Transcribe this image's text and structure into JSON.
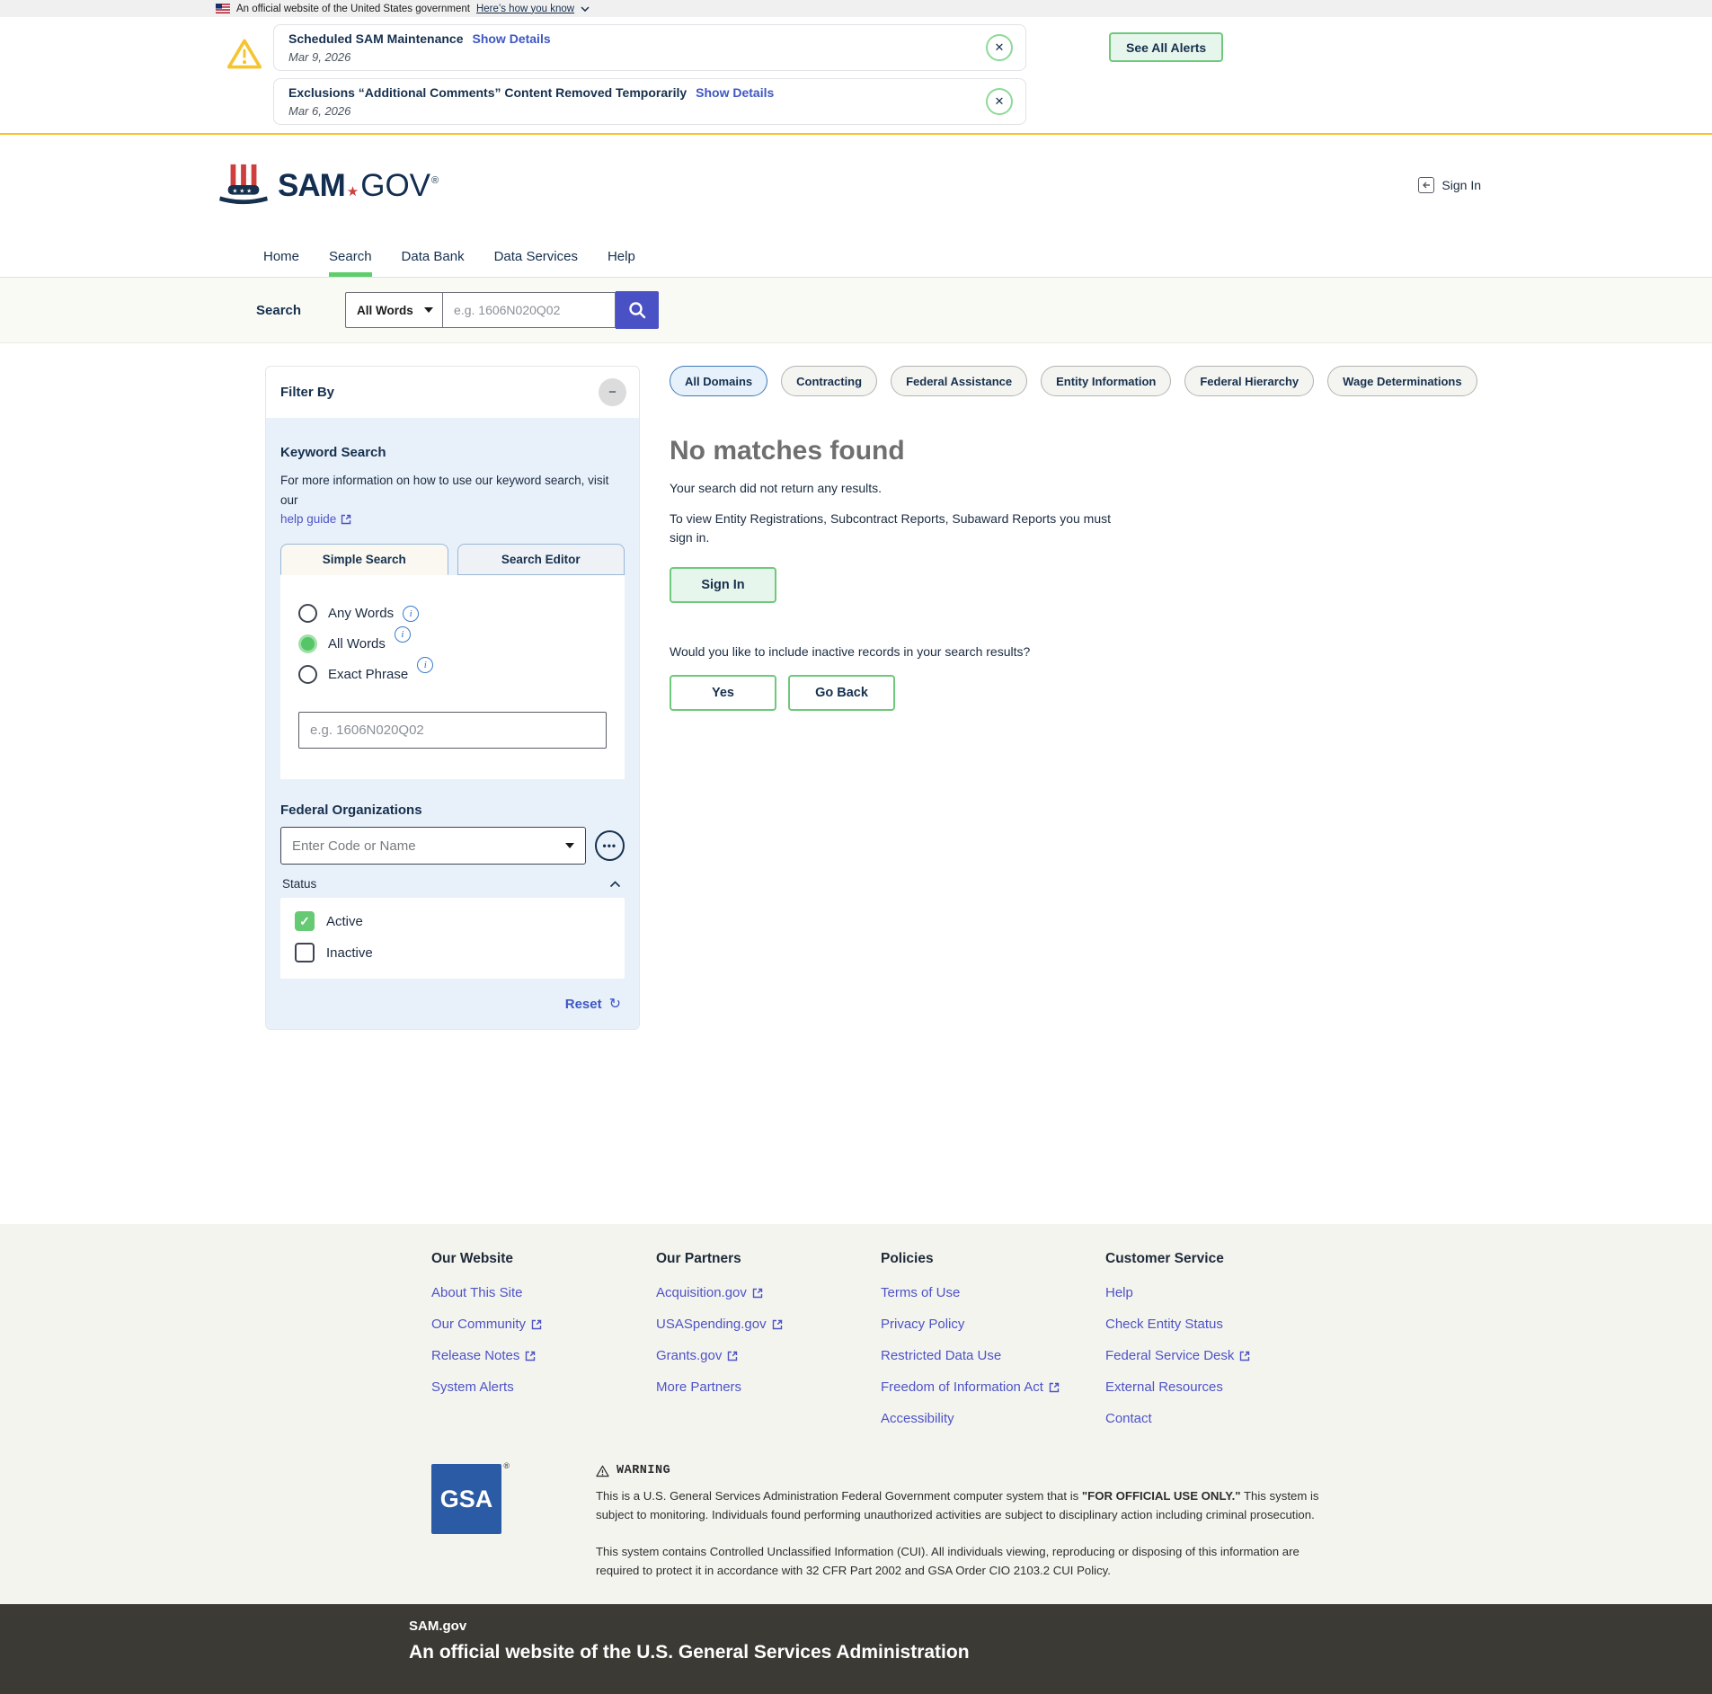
{
  "theme": {
    "accent_gold": "#ffbe2e",
    "brand_navy": "#16304e",
    "link_indigo": "#4d53c6",
    "success_green": "#6fc97c",
    "primary_blue": "#4a51c4",
    "gsa_blue": "#2c5ba6"
  },
  "gov_banner": {
    "text": "An official website of the United States government",
    "link": "Here’s how you know"
  },
  "alerts": {
    "items": [
      {
        "title": "Scheduled SAM Maintenance",
        "details_link": "Show Details",
        "date": "Mar 9, 2026"
      },
      {
        "title": "Exclusions “Additional Comments” Content Removed Temporarily",
        "details_link": "Show Details",
        "date": "Mar 6, 2026"
      }
    ],
    "see_all_label": "See All Alerts"
  },
  "header": {
    "logo": {
      "sam": "SAM",
      "gov": "GOV",
      "reg": "®"
    },
    "sign_in_label": "Sign In"
  },
  "nav": {
    "items": [
      {
        "label": "Home",
        "active": false
      },
      {
        "label": "Search",
        "active": true
      },
      {
        "label": "Data Bank",
        "active": false
      },
      {
        "label": "Data Services",
        "active": false
      },
      {
        "label": "Help",
        "active": false
      }
    ]
  },
  "search_bar": {
    "label": "Search",
    "type_value": "All Words",
    "placeholder": "e.g. 1606N020Q02"
  },
  "filter": {
    "title": "Filter By",
    "keyword": {
      "heading": "Keyword Search",
      "info_text": "For more information on how to use our keyword search, visit our",
      "help_link": "help guide",
      "tabs": [
        {
          "label": "Simple Search",
          "active": true
        },
        {
          "label": "Search Editor",
          "active": false
        }
      ],
      "radios": [
        {
          "label": "Any Words",
          "checked": false
        },
        {
          "label": "All Words",
          "checked": true
        },
        {
          "label": "Exact Phrase",
          "checked": false
        }
      ],
      "placeholder": "e.g. 1606N020Q02"
    },
    "federal_organizations": {
      "heading": "Federal Organizations",
      "placeholder": "Enter Code or Name",
      "status_label": "Status",
      "options": [
        {
          "label": "Active",
          "checked": true
        },
        {
          "label": "Inactive",
          "checked": false
        }
      ]
    },
    "reset_label": "Reset"
  },
  "domains": {
    "tabs": [
      {
        "label": "All Domains",
        "active": true
      },
      {
        "label": "Contracting",
        "active": false
      },
      {
        "label": "Federal Assistance",
        "active": false
      },
      {
        "label": "Entity Information",
        "active": false
      },
      {
        "label": "Federal Hierarchy",
        "active": false
      },
      {
        "label": "Wage Determinations",
        "active": false
      }
    ]
  },
  "results": {
    "heading": "No matches found",
    "message": "Your search did not return any results.",
    "sign_in_note": "To view Entity Registrations, Subcontract Reports, Subaward Reports you must sign in.",
    "sign_in_label": "Sign In",
    "inactive_question": "Would you like to include inactive records in your search results?",
    "yes_label": "Yes",
    "go_back_label": "Go Back"
  },
  "footer": {
    "columns": [
      {
        "heading": "Our Website",
        "links": [
          {
            "label": "About This Site",
            "external": false
          },
          {
            "label": "Our Community",
            "external": true
          },
          {
            "label": "Release Notes",
            "external": true
          },
          {
            "label": "System Alerts",
            "external": false
          }
        ]
      },
      {
        "heading": "Our Partners",
        "links": [
          {
            "label": "Acquisition.gov",
            "external": true
          },
          {
            "label": "USASpending.gov",
            "external": true
          },
          {
            "label": "Grants.gov",
            "external": true
          },
          {
            "label": "More Partners",
            "external": false
          }
        ]
      },
      {
        "heading": "Policies",
        "links": [
          {
            "label": "Terms of Use",
            "external": false
          },
          {
            "label": "Privacy Policy",
            "external": false
          },
          {
            "label": "Restricted Data Use",
            "external": false
          },
          {
            "label": "Freedom of Information Act",
            "external": true
          },
          {
            "label": "Accessibility",
            "external": false
          }
        ]
      },
      {
        "heading": "Customer Service",
        "links": [
          {
            "label": "Help",
            "external": false
          },
          {
            "label": "Check Entity Status",
            "external": false
          },
          {
            "label": "Federal Service Desk",
            "external": true
          },
          {
            "label": "External Resources",
            "external": false
          },
          {
            "label": "Contact",
            "external": false
          }
        ]
      }
    ],
    "gsa_logo": "GSA",
    "gsa_reg": "®",
    "warning": {
      "heading": "WARNING",
      "p1_before": "This is a U.S. General Services Administration Federal Government computer system that is ",
      "p1_bold": "\"FOR OFFICIAL USE ONLY.\"",
      "p1_after": " This system is subject to monitoring. Individuals found performing unauthorized activities are subject to disciplinary action including criminal prosecution.",
      "p2": "This system contains Controlled Unclassified Information (CUI). All individuals viewing, reproducing or disposing of this information are required to protect it in accordance with 32 CFR Part 2002 and GSA Order CIO 2103.2 CUI Policy."
    },
    "dark": {
      "line1": "SAM.gov",
      "line2": "An official website of the U.S. General Services Administration"
    }
  }
}
